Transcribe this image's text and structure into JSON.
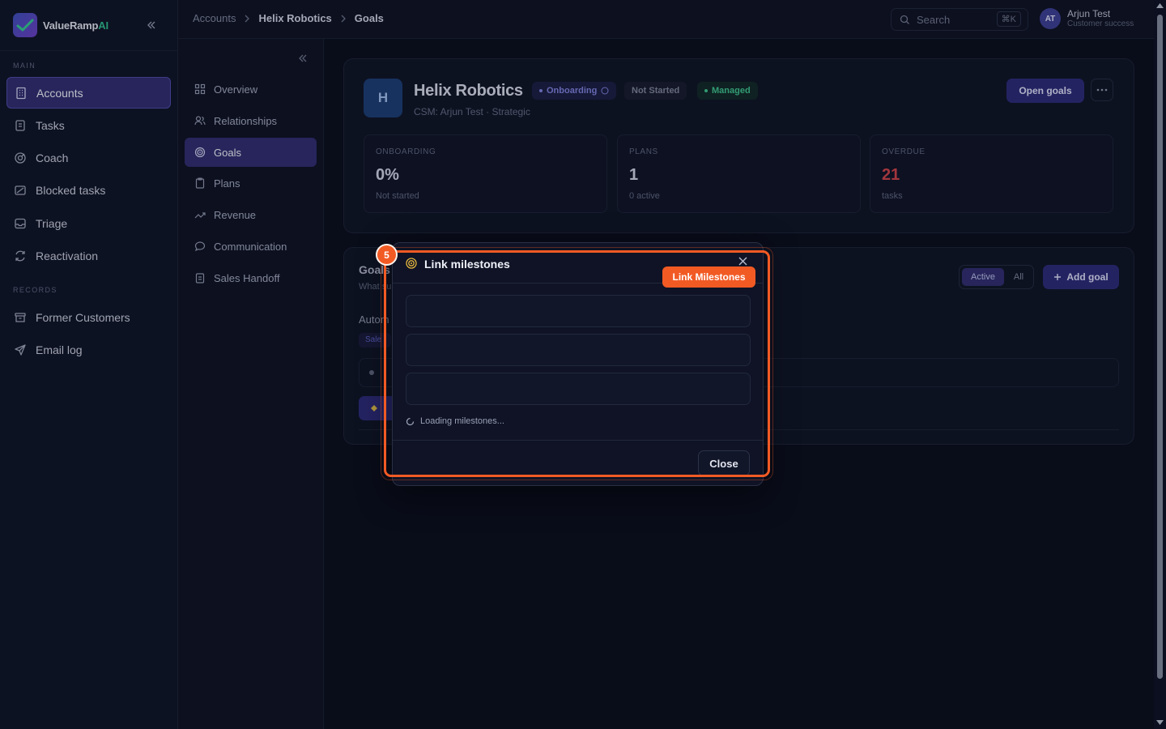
{
  "app": {
    "name_main": "ValueRamp",
    "name_accent": "AI"
  },
  "sidebar": {
    "section_main": "MAIN",
    "section_records": "RECORDS",
    "items": [
      {
        "label": "Accounts",
        "icon": "building-icon"
      },
      {
        "label": "Tasks",
        "icon": "clipboard-icon"
      },
      {
        "label": "Coach",
        "icon": "compass-icon"
      },
      {
        "label": "Blocked tasks",
        "icon": "blocked-icon"
      },
      {
        "label": "Triage",
        "icon": "inbox-icon"
      },
      {
        "label": "Reactivation",
        "icon": "refresh-icon"
      }
    ],
    "records": [
      {
        "label": "Former Customers",
        "icon": "archive-icon"
      },
      {
        "label": "Email log",
        "icon": "send-icon"
      }
    ],
    "active": "Accounts"
  },
  "subnav": {
    "items": [
      {
        "label": "Overview",
        "icon": "grid-icon"
      },
      {
        "label": "Relationships",
        "icon": "users-icon"
      },
      {
        "label": "Goals",
        "icon": "target-icon"
      },
      {
        "label": "Plans",
        "icon": "clipboard-icon"
      },
      {
        "label": "Revenue",
        "icon": "trend-icon"
      },
      {
        "label": "Communication",
        "icon": "chat-icon"
      },
      {
        "label": "Sales Handoff",
        "icon": "clipboard-icon"
      }
    ],
    "active": "Goals"
  },
  "breadcrumb": [
    "Accounts",
    "Helix Robotics",
    "Goals"
  ],
  "search": {
    "placeholder": "Search",
    "shortcut": "⌘K"
  },
  "user": {
    "initials": "AT",
    "name": "Arjun Test",
    "role": "Customer success"
  },
  "account": {
    "initial": "H",
    "name": "Helix Robotics",
    "badges": [
      {
        "label": "Onboarding",
        "color": "#7c7fd9"
      },
      {
        "label": "Not Started",
        "color": "#7b8198"
      },
      {
        "label": "Managed",
        "color": "#3fbf8e"
      }
    ],
    "subline": "CSM: Arjun Test · Strategic",
    "open_goals_label": "Open goals",
    "stats": [
      {
        "label": "ONBOARDING",
        "value": "0%",
        "sub": "Not started"
      },
      {
        "label": "PLANS",
        "value": "1",
        "sub": "0 active"
      },
      {
        "label": "OVERDUE",
        "value": "21",
        "sub": "tasks",
        "value_color": "#d94a52"
      }
    ]
  },
  "goals": {
    "title_fragment": "Goals",
    "subtitle_fragment": "What su",
    "auto_fragment": "Autom",
    "tag_fragment": "Sale",
    "filter_active": "Active",
    "filter_all": "All",
    "add_goal_label": "Add goal"
  },
  "modal": {
    "title": "Link milestones",
    "loading_text": "Loading milestones...",
    "close_label": "Close"
  },
  "annotation": {
    "step": "5",
    "tag": "Link Milestones",
    "color": "#f25a24"
  }
}
